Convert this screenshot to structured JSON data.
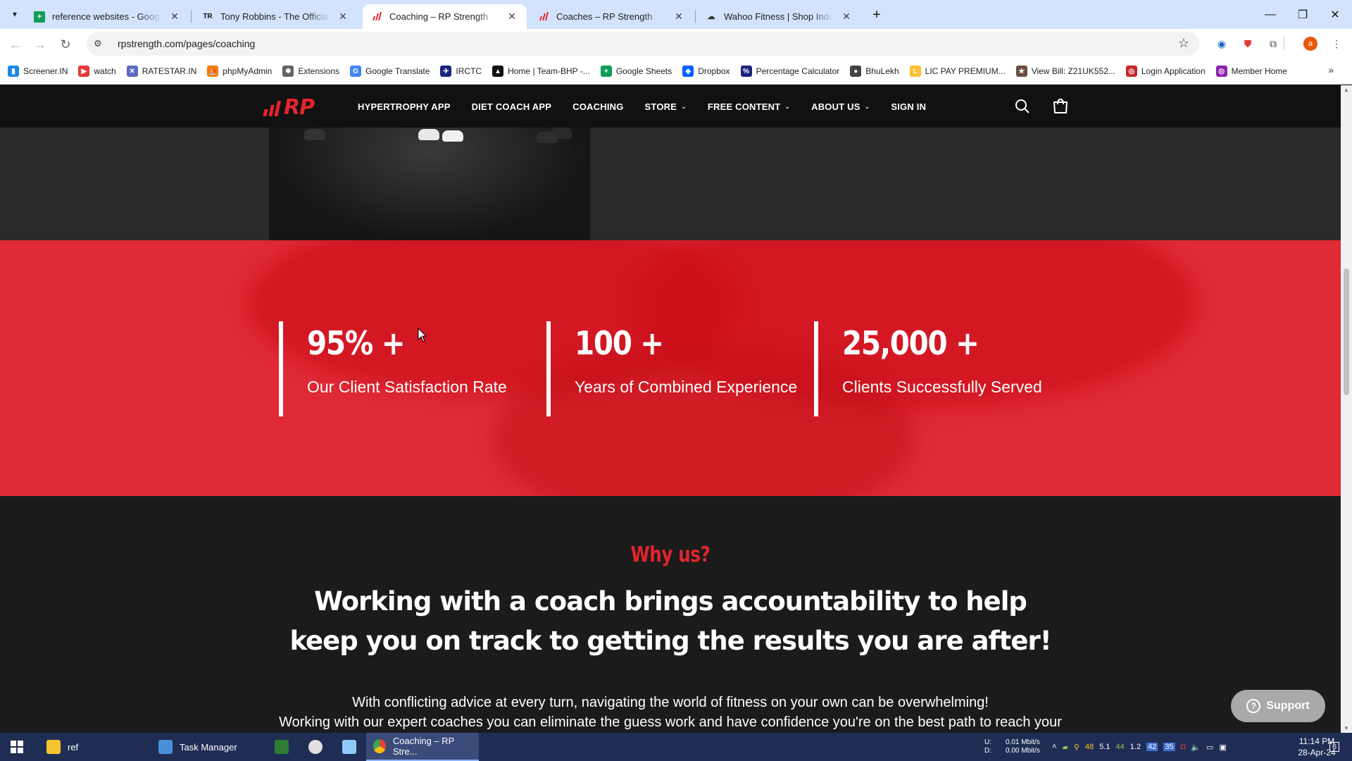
{
  "browser": {
    "tabs": [
      {
        "title": "reference websites - Google Sh",
        "icon": "sheets",
        "active": false
      },
      {
        "title": "Tony Robbins - The Official Wel",
        "icon": "TR",
        "active": false
      },
      {
        "title": "Coaching – RP Strength",
        "icon": "rp",
        "active": true
      },
      {
        "title": "Coaches – RP Strength",
        "icon": "rp",
        "active": false
      },
      {
        "title": "Wahoo Fitness | Shop Indoor B",
        "icon": "wahoo",
        "active": false
      }
    ],
    "url": "rpstrength.com/pages/coaching",
    "bookmarks": [
      {
        "label": "Screener.IN",
        "color": "#1e88e5",
        "glyph": "▮"
      },
      {
        "label": "watch",
        "color": "#e53935",
        "glyph": "▶"
      },
      {
        "label": "RATESTAR.IN",
        "color": "#5c6bc0",
        "glyph": "✕"
      },
      {
        "label": "phpMyAdmin",
        "color": "#f57c00",
        "glyph": "⛵"
      },
      {
        "label": "Extensions",
        "color": "#5f6368",
        "glyph": "✱"
      },
      {
        "label": "Google Translate",
        "color": "#4285f4",
        "glyph": "G"
      },
      {
        "label": "IRCTC",
        "color": "#1a237e",
        "glyph": "✈"
      },
      {
        "label": "Home | Team-BHP -...",
        "color": "#111111",
        "glyph": "▲"
      },
      {
        "label": "Google Sheets",
        "color": "#0f9d58",
        "glyph": "+"
      },
      {
        "label": "Dropbox",
        "color": "#0061ff",
        "glyph": "◆"
      },
      {
        "label": "Percentage Calculator",
        "color": "#1a237e",
        "glyph": "%"
      },
      {
        "label": "BhuLekh",
        "color": "#424242",
        "glyph": "●"
      },
      {
        "label": "LIC PAY PREMIUM...",
        "color": "#fbc02d",
        "glyph": "L"
      },
      {
        "label": "View Bill: Z21UK552...",
        "color": "#6d4c41",
        "glyph": "★"
      },
      {
        "label": "Login Application",
        "color": "#c62828",
        "glyph": "◎"
      },
      {
        "label": "Member Home",
        "color": "#8e24aa",
        "glyph": "◎"
      }
    ],
    "avatar_letter": "a"
  },
  "site": {
    "nav": [
      {
        "label": "HYPERTROPHY APP",
        "dropdown": false
      },
      {
        "label": "DIET COACH APP",
        "dropdown": false
      },
      {
        "label": "COACHING",
        "dropdown": false
      },
      {
        "label": "STORE",
        "dropdown": true
      },
      {
        "label": "FREE CONTENT",
        "dropdown": true
      },
      {
        "label": "ABOUT US",
        "dropdown": true
      },
      {
        "label": "SIGN IN",
        "dropdown": false
      }
    ],
    "accent_color": "#e3242b",
    "stats": [
      {
        "value": "95% +",
        "label": "Our Client Satisfaction Rate"
      },
      {
        "value": "100 +",
        "label": "Years of Combined Experience"
      },
      {
        "value": "25,000 +",
        "label": "Clients Successfully Served"
      }
    ],
    "why": {
      "eyebrow": "Why us?",
      "heading": "Working with a coach brings accountability to help keep you on track to getting the results you are after!",
      "body": "With conflicting advice at every turn, navigating the world of fitness on your own can be overwhelming!",
      "body_cut": "Working with our expert coaches you can eliminate the guess work and have confidence you're on the best path to reach your"
    },
    "support_label": "Support"
  },
  "taskbar": {
    "items": [
      {
        "label": "ref",
        "color": "#f4c430",
        "active": false
      },
      {
        "label": "Task Manager",
        "color": "#4a90d9",
        "active": false
      },
      {
        "label": "",
        "color": "#2e7d32",
        "active": false
      },
      {
        "label": "",
        "color": "#e0e0e0",
        "active": false
      },
      {
        "label": "",
        "color": "#90caf9",
        "active": false
      },
      {
        "label": "Coaching – RP Stre...",
        "color": "#ea4335",
        "active": true
      }
    ],
    "net_up": "0.01 Mbit/s",
    "net_down": "0.00 Mbit/s",
    "net_up_label": "U:",
    "net_down_label": "D:",
    "tray_nums": [
      "48",
      "5.1",
      "44",
      "1.2"
    ],
    "time": "11:14 PM",
    "date": "28-Apr-24",
    "notif_count": "6"
  }
}
